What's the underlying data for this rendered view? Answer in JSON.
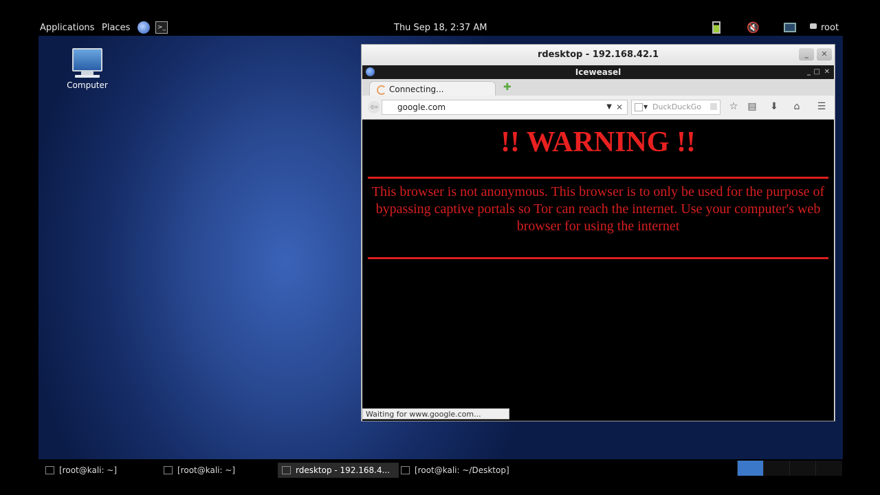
{
  "top_panel": {
    "applications": "Applications",
    "places": "Places",
    "clock": "Thu Sep 18,  2:37 AM",
    "user": "root"
  },
  "desktop": {
    "computer_label": "Computer"
  },
  "rdesktop": {
    "title": "rdesktop - 192.168.42.1",
    "minimize": "_",
    "close": "✕"
  },
  "iceweasel": {
    "title": "Iceweasel",
    "tab_label": "Connecting...",
    "url": "google.com",
    "search_placeholder": "DuckDuckGo",
    "status": "Waiting for www.google.com...",
    "page": {
      "heading": "!! WARNING !!",
      "message": "This browser is not anonymous. This browser is to only be used for the purpose of bypassing captive portals so Tor can reach the internet. Use your computer's web browser for using the internet"
    }
  },
  "taskbar": {
    "items": [
      {
        "label": "[root@kali: ~]"
      },
      {
        "label": "[root@kali: ~]"
      },
      {
        "label": "rdesktop - 192.168.4..."
      },
      {
        "label": "[root@kali: ~/Desktop]"
      }
    ]
  }
}
